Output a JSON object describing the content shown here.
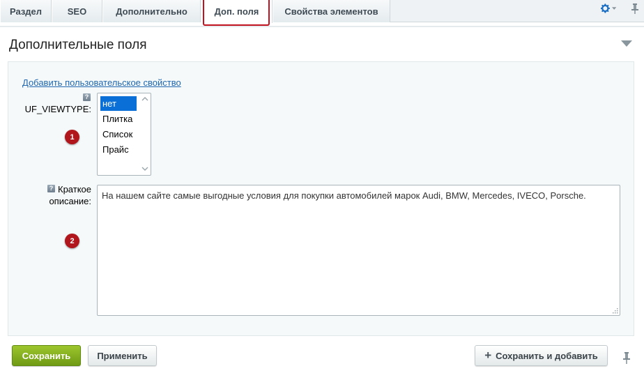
{
  "tabs": [
    {
      "label": "Раздел",
      "active": false
    },
    {
      "label": "SEO",
      "active": false
    },
    {
      "label": "Дополнительно",
      "active": false
    },
    {
      "label": "Доп. поля",
      "active": true
    },
    {
      "label": "Свойства элементов",
      "active": false
    }
  ],
  "section": {
    "title": "Дополнительные поля",
    "add_link": "Добавить пользовательское свойство"
  },
  "fields": {
    "viewtype": {
      "label": "UF_VIEWTYPE:",
      "help": "?",
      "options": [
        "нет",
        "Плитка",
        "Список",
        "Прайс"
      ],
      "selected": "нет"
    },
    "description": {
      "label_line1": "Краткое",
      "label_line2": "описание:",
      "help": "?",
      "value": "На нашем сайте самые выгодные условия для покупки автомобилей марок Audi, BMW, Mercedes, IVECO, Porsche."
    }
  },
  "badges": [
    "1",
    "2"
  ],
  "buttons": {
    "save": "Сохранить",
    "apply": "Применить",
    "save_add": "Сохранить и добавить"
  },
  "icons": {
    "settings": "gear-icon",
    "pin": "pin-icon",
    "collapse": "triangle-down-icon",
    "plus": "plus-icon"
  },
  "colors": {
    "accent_green": "#7aa61b",
    "link_blue": "#2067b0",
    "highlight_red": "#c1121f",
    "selected_blue": "#0a6fd6",
    "gear_blue": "#1a6fc4"
  }
}
